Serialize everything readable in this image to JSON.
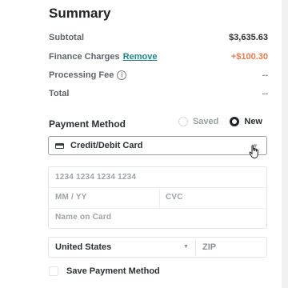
{
  "summary": {
    "title": "Summary",
    "subtotal_label": "Subtotal",
    "subtotal_value": "$3,635.63",
    "finance_label": "Finance Charges",
    "finance_link": "Remove",
    "finance_value": "+$100.30",
    "processing_label": "Processing Fee",
    "processing_value": "--",
    "total_label": "Total",
    "total_value": "--"
  },
  "payment": {
    "label": "Payment Method",
    "saved_label": "Saved",
    "new_label": "New",
    "selected_option": "New",
    "method_value": "Credit/Debit Card"
  },
  "card_form": {
    "number_placeholder": "1234 1234 1234 1234",
    "expiry_placeholder": "MM / YY",
    "cvc_placeholder": "CVC",
    "name_placeholder": "Name on Card"
  },
  "address": {
    "country_value": "United States",
    "zip_placeholder": "ZIP"
  },
  "save_method_label": "Save Payment Method",
  "colors": {
    "accent_link": "#1f8a86",
    "finance_charge": "#ef7a4a"
  }
}
